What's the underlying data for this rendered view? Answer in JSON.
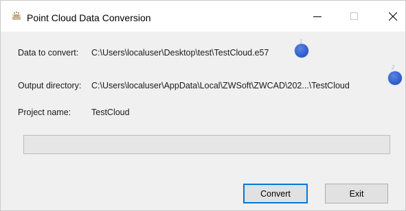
{
  "window": {
    "title": "Point Cloud Data Conversion",
    "controls": {
      "minimize": "—",
      "maximize": "☐",
      "close": "✕"
    }
  },
  "fields": {
    "data_to_convert": {
      "label": "Data to convert:",
      "value": "C:\\Users\\localuser\\Desktop\\test\\TestCloud.e57"
    },
    "output_directory": {
      "label": "Output directory:",
      "value": "C:\\Users\\localuser\\AppData\\Local\\ZWSoft\\ZWCAD\\202...\\TestCloud"
    },
    "project_name": {
      "label": "Project name:",
      "value": "TestCloud"
    }
  },
  "markers": [
    {
      "number": "1"
    },
    {
      "number": "2"
    }
  ],
  "progress": {
    "fraction": 0.0
  },
  "buttons": {
    "convert": "Convert",
    "exit": "Exit"
  },
  "colors": {
    "marker": "#2f5fd0",
    "focus_border": "#0078d7",
    "progress_fill": "#06b025"
  }
}
